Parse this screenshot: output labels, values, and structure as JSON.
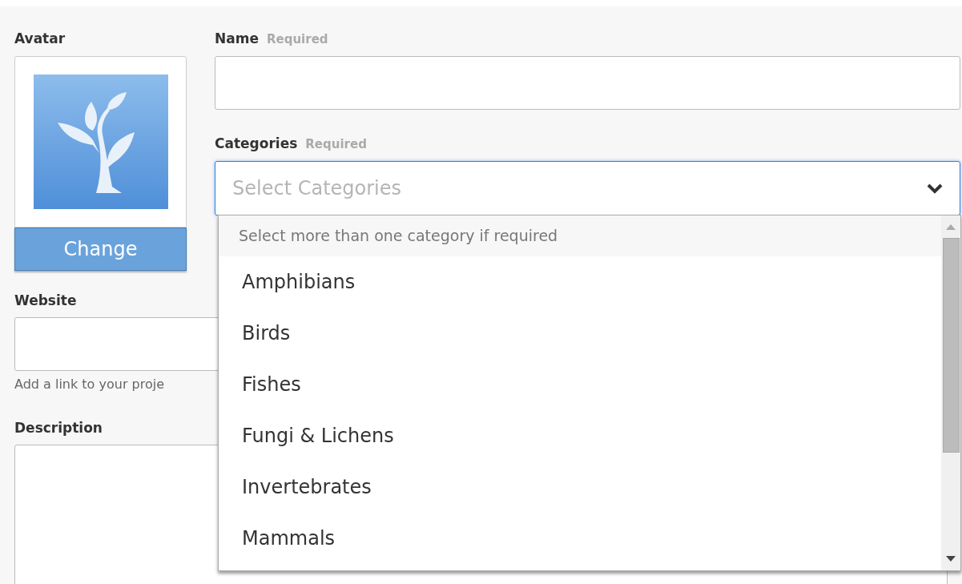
{
  "avatar": {
    "label": "Avatar",
    "button": "Change"
  },
  "name": {
    "label": "Name",
    "required": "Required"
  },
  "categories": {
    "label": "Categories",
    "required": "Required",
    "placeholder": "Select Categories",
    "expanded": true,
    "dropdown": {
      "hint": "Select more than one category if required",
      "options": [
        "Amphibians",
        "Birds",
        "Fishes",
        "Fungi & Lichens",
        "Invertebrates",
        "Mammals"
      ]
    }
  },
  "website": {
    "label": "Website",
    "hint": "Add a link to your proje"
  },
  "description": {
    "label": "Description"
  }
}
